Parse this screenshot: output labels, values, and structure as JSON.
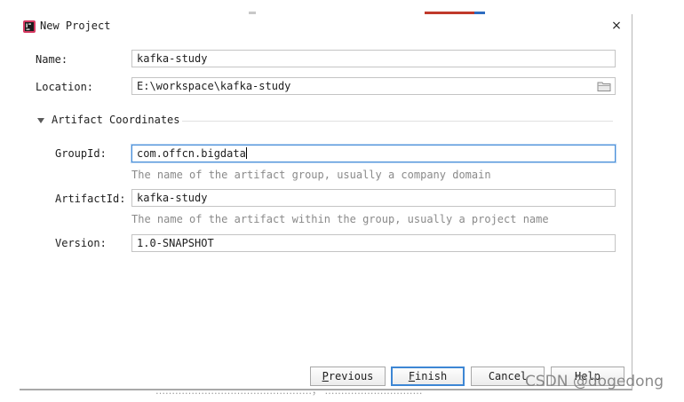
{
  "dialog": {
    "title": "New Project",
    "close_symbol": "×",
    "icons": {
      "app": "intellij-idea-icon",
      "close": "close-icon",
      "folder": "folder-icon",
      "collapse": "triangle-down-icon"
    }
  },
  "project": {
    "name_label": "Name:",
    "name_value": "kafka-study",
    "location_label": "Location:",
    "location_value": "E:\\workspace\\kafka-study"
  },
  "artifact": {
    "section_title": "Artifact Coordinates",
    "group_label": "GroupId:",
    "group_value": "com.offcn.bigdata",
    "group_hint": "The name of the artifact group, usually a company domain",
    "artifact_label": "ArtifactId:",
    "artifact_value": "kafka-study",
    "artifact_hint": "The name of the artifact within the group, usually a project name",
    "version_label": "Version:",
    "version_value": "1.0-SNAPSHOT"
  },
  "buttons": {
    "previous": {
      "mnemonic": "P",
      "rest": "revious"
    },
    "finish": {
      "mnemonic": "F",
      "rest": "inish"
    },
    "cancel": "Cancel",
    "help": "Help"
  },
  "watermark": "CSDN @dogedong",
  "background_text": "…………………………………………，  …………………………"
}
